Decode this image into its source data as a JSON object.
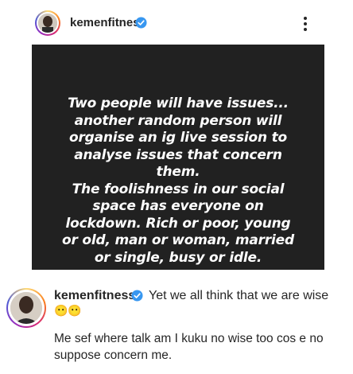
{
  "header": {
    "username": "kemenfitness",
    "verified": true
  },
  "post": {
    "lines": [
      "Two people will have issues...",
      "another random person will",
      "organise an ig live session to",
      "analyse issues that concern",
      "them.",
      "The foolishness in our social",
      "space has everyone on",
      "lockdown. Rich or poor, young",
      "or old, man or woman, married",
      "or single, busy or idle."
    ],
    "background": "#212121"
  },
  "comment": {
    "username": "kemenfitness",
    "caption": "Yet we all think that we are wise",
    "emoji": "😶😶"
  },
  "reply": {
    "text": "Me sef where talk am I kuku no wise too cos e no suppose concern me."
  },
  "colors": {
    "verified": "#3897f0",
    "text": "#262626"
  }
}
